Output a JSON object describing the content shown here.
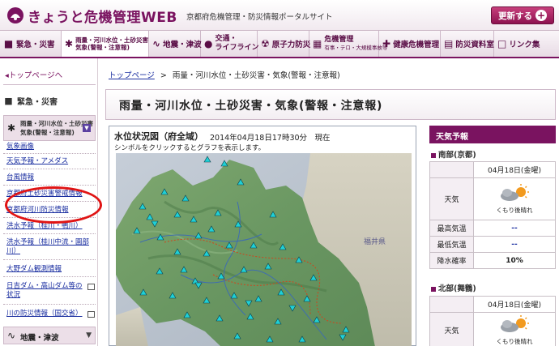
{
  "header": {
    "logo": "きょうと危機管理WEB",
    "subtitle": "京都府危機管理・防災情報ポータルサイト",
    "size_button": "更新する"
  },
  "nav": {
    "items": [
      {
        "label": "緊急・災害",
        "icon": "alert-icon"
      },
      {
        "label": "雨量・河川水位・土砂災害",
        "label2": "気象(警報・注意報)",
        "icon": "asterisk-icon",
        "active": true
      },
      {
        "label": "地震・津波",
        "icon": "wave-icon"
      },
      {
        "label": "交通・",
        "label2": "ライフライン",
        "icon": "car-icon"
      },
      {
        "label": "原子力防災",
        "icon": "radiation-icon"
      },
      {
        "label": "危機管理",
        "label2": "有事・テロ・大規模事故等",
        "icon": "building-icon"
      },
      {
        "label": "健康危機管理",
        "icon": "cross-icon"
      },
      {
        "label": "防災資料室",
        "icon": "book-icon"
      },
      {
        "label": "リンク集",
        "icon": "link-icon"
      }
    ]
  },
  "sidebar": {
    "top_link": "◂トップページへ",
    "cat_emergency": "緊急・災害",
    "cat_active_line1": "雨量・河川水位・土砂災害",
    "cat_active_line2": "気象(警報・注意報)",
    "links": [
      "気象画像",
      "天気予報・アメダス",
      "台風情報",
      "京都府土砂災害警戒情報",
      "京都府河川防災情報",
      "洪水予報（桂川・鴨川）",
      "洪水予報（桂川中流・園部川）",
      "大野ダム観測情報",
      "日吉ダム・高山ダム等の状況",
      "川の防災情報（国交省）"
    ],
    "cat_quake": "地震・津波"
  },
  "breadcrumb": {
    "home": "トップページ",
    "sep": ">",
    "current": "雨量・河川水位・土砂災害・気象(警報・注意報)"
  },
  "page_title": "雨量・河川水位・土砂災害・気象(警報・注意報)",
  "map": {
    "title": "水位状況図（府全域）",
    "time": "2014年04月18日17時30分　現在",
    "note": "シンボルをクリックするとグラフを表示します。",
    "fukui_label": "福井県"
  },
  "weather": {
    "heading": "天気予報",
    "south": {
      "region": "南部(京都)",
      "date": "04月18日(金曜)",
      "weather_label": "天気",
      "weather_text": "くもり後晴れ",
      "max_label": "最高気温",
      "max_value": "--",
      "min_label": "最低気温",
      "min_value": "--",
      "rain_label": "降水確率",
      "rain_value": "10%"
    },
    "north": {
      "region": "北部(舞鶴)",
      "date": "04月18日(金曜)",
      "weather_label": "天気",
      "weather_text": "くもり後晴れ"
    }
  }
}
